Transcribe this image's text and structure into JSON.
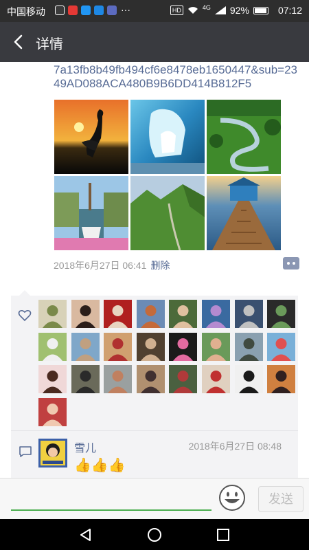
{
  "status_bar": {
    "carrier": "中国移动",
    "network": "4G",
    "battery": "92%",
    "time": "07:12",
    "hd": "HD"
  },
  "header": {
    "title": "详情"
  },
  "post": {
    "link_text": "7a13fb8b49fb494cf6e8478eb1650447&sub=2349AD088ACA480B9B6DD414B812F5",
    "photos": [
      "crane-sunset",
      "ice-cave",
      "river-meadow",
      "canal-boat",
      "green-valley",
      "boathouse-pier"
    ],
    "date": "2018年6月27日 06:41",
    "delete_label": "删除"
  },
  "likes": {
    "count": 25
  },
  "comments": [
    {
      "name": "雪儿",
      "time": "2018年6月27日 08:48",
      "text": "👍👍👍"
    }
  ],
  "input": {
    "placeholder": "",
    "send_label": "发送"
  },
  "colors": {
    "link": "#576b95",
    "header_bg": "#393a3f",
    "status_bg": "#2e2e2e",
    "panel_bg": "#f3f3f5",
    "input_line": "#4caf50"
  }
}
